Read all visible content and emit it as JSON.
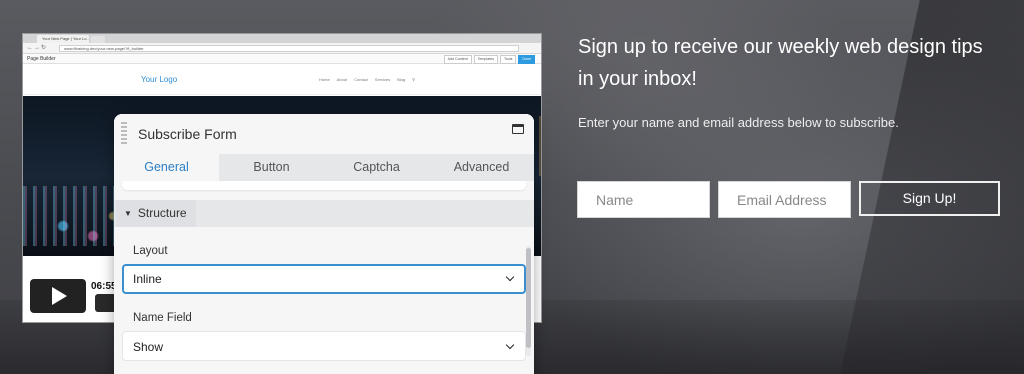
{
  "browser": {
    "tab_title": "Your New Page | Your Lo...",
    "url": "www.fltraining.dev/your-new-page/?fl_builder",
    "page_builder_title": "Page Builder",
    "toolbar_buttons": [
      "Add Content",
      "Templates",
      "Tools",
      "Done"
    ],
    "site_logo": "Your Logo",
    "site_nav": [
      "Home",
      "About",
      "Contact",
      "Services",
      "Blog"
    ],
    "video_time": "06:55"
  },
  "panel": {
    "title": "Subscribe Form",
    "tabs": [
      "General",
      "Button",
      "Captcha",
      "Advanced"
    ],
    "active_tab": "General",
    "section": "Structure",
    "fields": [
      {
        "label": "Layout",
        "value": "Inline"
      },
      {
        "label": "Name Field",
        "value": "Show"
      }
    ]
  },
  "signup": {
    "heading": "Sign up to receive our weekly web design tips in your inbox!",
    "subtext": "Enter your name and email address below to subscribe.",
    "name_placeholder": "Name",
    "email_placeholder": "Email Address",
    "button_label": "Sign Up!"
  },
  "colors": {
    "accent": "#2b7fc4",
    "focus_border": "#3a8fd0",
    "background": "#4a4b50"
  }
}
